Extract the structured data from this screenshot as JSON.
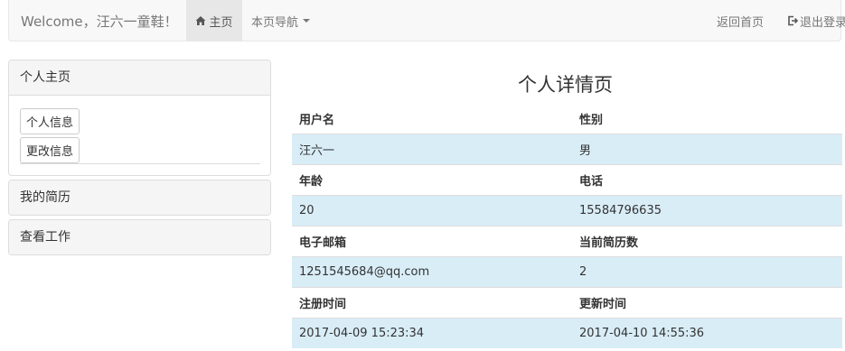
{
  "navbar": {
    "brand": "Welcome，汪六一童鞋！",
    "home_label": "主页",
    "menu_label": "本页导航",
    "back_label": "返回首页",
    "logout_label": "退出登录"
  },
  "sidebar": {
    "panel_personal_title": "个人主页",
    "btn_info": "个人信息",
    "btn_edit": "更改信息",
    "panel_resume_title": "我的简历",
    "panel_jobs_title": "查看工作"
  },
  "detail": {
    "title": "个人详情页",
    "rows": [
      {
        "label1": "用户名",
        "label2": "性别",
        "value1": "汪六一",
        "value2": "男"
      },
      {
        "label1": "年龄",
        "label2": "电话",
        "value1": "20",
        "value2": "15584796635"
      },
      {
        "label1": "电子邮箱",
        "label2": "当前简历数",
        "value1": "1251545684@qq.com",
        "value2": "2"
      },
      {
        "label1": "注册时间",
        "label2": "更新时间",
        "value1": "2017-04-09 15:23:34",
        "value2": "2017-04-10 14:55:36"
      }
    ]
  },
  "colors": {
    "navbar_bg": "#f8f8f8",
    "active_nav_bg": "#e7e7e7",
    "row_highlight": "#d9edf7"
  },
  "icons": {
    "home": "home-icon",
    "logout": "logout-icon",
    "menu": "caret-down-icon"
  }
}
